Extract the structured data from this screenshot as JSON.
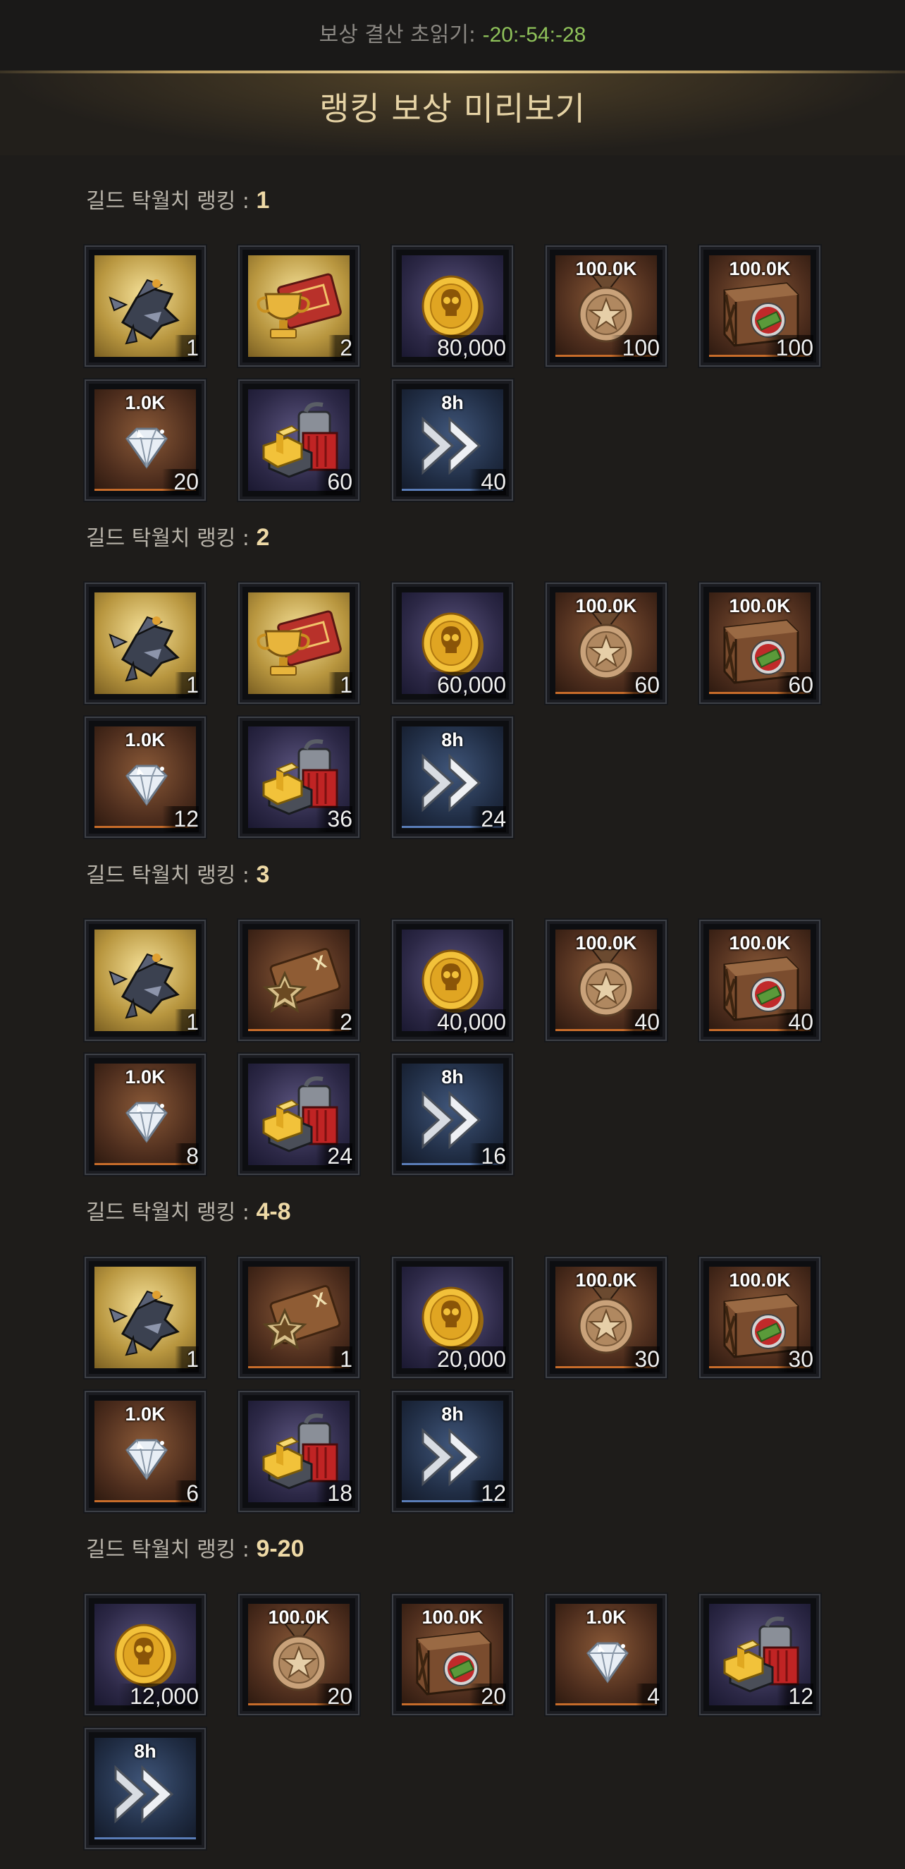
{
  "header": {
    "timer_label": "보상 결산 초읽기:",
    "timer_value": "-20:-54:-28",
    "title": "랭킹 보상 미리보기"
  },
  "icon_names": {
    "mech": "mech-unit-icon",
    "trophy_ticket": "trophy-ticket-icon",
    "star_ticket": "star-ticket-icon",
    "coin": "skull-coin-icon",
    "medal": "star-medal-icon",
    "crate": "cash-crate-icon",
    "diamond": "diamond-icon",
    "resources": "resource-pack-icon",
    "speedup": "speedup-icon"
  },
  "sections": [
    {
      "label": "길드 탁월치 랭킹 : ",
      "rank": "1",
      "items": [
        {
          "icon": "mech",
          "bg": "gold",
          "tag": "",
          "qty": "1"
        },
        {
          "icon": "trophy_ticket",
          "bg": "gold",
          "tag": "",
          "qty": "2"
        },
        {
          "icon": "coin",
          "bg": "purple",
          "tag": "",
          "qty": "80,000"
        },
        {
          "icon": "medal",
          "bg": "orange",
          "tag": "100.0K",
          "qty": "100"
        },
        {
          "icon": "crate",
          "bg": "orange",
          "tag": "100.0K",
          "qty": "100"
        },
        {
          "icon": "diamond",
          "bg": "orange",
          "tag": "1.0K",
          "qty": "20"
        },
        {
          "icon": "resources",
          "bg": "purple",
          "tag": "",
          "qty": "60"
        },
        {
          "icon": "speedup",
          "bg": "blue",
          "tag": "8h",
          "qty": "40"
        }
      ]
    },
    {
      "label": "길드 탁월치 랭킹 : ",
      "rank": "2",
      "items": [
        {
          "icon": "mech",
          "bg": "gold",
          "tag": "",
          "qty": "1"
        },
        {
          "icon": "trophy_ticket",
          "bg": "gold",
          "tag": "",
          "qty": "1"
        },
        {
          "icon": "coin",
          "bg": "purple",
          "tag": "",
          "qty": "60,000"
        },
        {
          "icon": "medal",
          "bg": "orange",
          "tag": "100.0K",
          "qty": "60"
        },
        {
          "icon": "crate",
          "bg": "orange",
          "tag": "100.0K",
          "qty": "60"
        },
        {
          "icon": "diamond",
          "bg": "orange",
          "tag": "1.0K",
          "qty": "12"
        },
        {
          "icon": "resources",
          "bg": "purple",
          "tag": "",
          "qty": "36"
        },
        {
          "icon": "speedup",
          "bg": "blue",
          "tag": "8h",
          "qty": "24"
        }
      ]
    },
    {
      "label": "길드 탁월치 랭킹 : ",
      "rank": "3",
      "items": [
        {
          "icon": "mech",
          "bg": "gold",
          "tag": "",
          "qty": "1"
        },
        {
          "icon": "star_ticket",
          "bg": "orange",
          "tag": "",
          "qty": "2"
        },
        {
          "icon": "coin",
          "bg": "purple",
          "tag": "",
          "qty": "40,000"
        },
        {
          "icon": "medal",
          "bg": "orange",
          "tag": "100.0K",
          "qty": "40"
        },
        {
          "icon": "crate",
          "bg": "orange",
          "tag": "100.0K",
          "qty": "40"
        },
        {
          "icon": "diamond",
          "bg": "orange",
          "tag": "1.0K",
          "qty": "8"
        },
        {
          "icon": "resources",
          "bg": "purple",
          "tag": "",
          "qty": "24"
        },
        {
          "icon": "speedup",
          "bg": "blue",
          "tag": "8h",
          "qty": "16"
        }
      ]
    },
    {
      "label": "길드 탁월치 랭킹 : ",
      "rank": "4-8",
      "items": [
        {
          "icon": "mech",
          "bg": "gold",
          "tag": "",
          "qty": "1"
        },
        {
          "icon": "star_ticket",
          "bg": "orange",
          "tag": "",
          "qty": "1"
        },
        {
          "icon": "coin",
          "bg": "purple",
          "tag": "",
          "qty": "20,000"
        },
        {
          "icon": "medal",
          "bg": "orange",
          "tag": "100.0K",
          "qty": "30"
        },
        {
          "icon": "crate",
          "bg": "orange",
          "tag": "100.0K",
          "qty": "30"
        },
        {
          "icon": "diamond",
          "bg": "orange",
          "tag": "1.0K",
          "qty": "6"
        },
        {
          "icon": "resources",
          "bg": "purple",
          "tag": "",
          "qty": "18"
        },
        {
          "icon": "speedup",
          "bg": "blue",
          "tag": "8h",
          "qty": "12"
        }
      ]
    },
    {
      "label": "길드 탁월치 랭킹 : ",
      "rank": "9-20",
      "items": [
        {
          "icon": "coin",
          "bg": "purple",
          "tag": "",
          "qty": "12,000"
        },
        {
          "icon": "medal",
          "bg": "orange",
          "tag": "100.0K",
          "qty": "20"
        },
        {
          "icon": "crate",
          "bg": "orange",
          "tag": "100.0K",
          "qty": "20"
        },
        {
          "icon": "diamond",
          "bg": "orange",
          "tag": "1.0K",
          "qty": "4"
        },
        {
          "icon": "resources",
          "bg": "purple",
          "tag": "",
          "qty": "12"
        },
        {
          "icon": "speedup",
          "bg": "blue",
          "tag": "8h",
          "qty": ""
        }
      ]
    }
  ]
}
